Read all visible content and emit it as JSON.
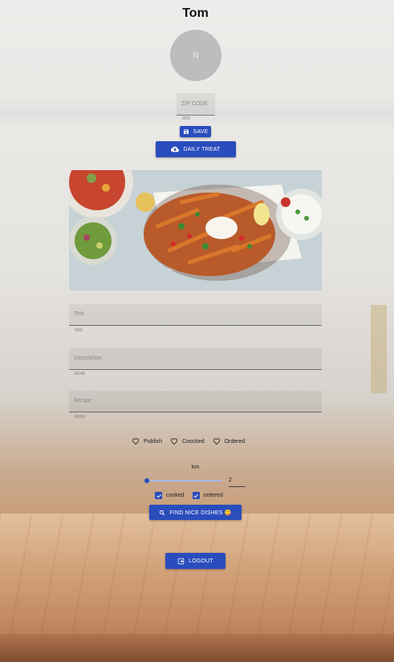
{
  "profile": {
    "name": "Tom",
    "avatar_initial": "N"
  },
  "zip": {
    "placeholder": "ZIP CODE",
    "value": "",
    "counter": "0/20"
  },
  "buttons": {
    "save": "SAVE",
    "daily_treat": "DAILY TREAT",
    "find_dishes": "FIND NICE DISHES 😋",
    "logout": "LOGOUT"
  },
  "form": {
    "title": {
      "label": "Title",
      "counter": "0/20"
    },
    "description": {
      "label": "Description",
      "counter": "0/140"
    },
    "recipe": {
      "label": "Recipe",
      "counter": "0/500"
    }
  },
  "status_options": [
    "Publish",
    "Coocked",
    "Ordered"
  ],
  "filter": {
    "unit_label": "km",
    "distance_value": "2",
    "checkboxes": [
      {
        "label": "cooked",
        "checked": true
      },
      {
        "label": "ordered",
        "checked": true
      }
    ]
  },
  "colors": {
    "primary": "#2a4dbd",
    "avatar_bg": "#bdbdbd"
  },
  "icons": {
    "save": "floppy-disk-icon",
    "daily_treat": "cloud-upload-icon",
    "find": "search-icon",
    "logout": "logout-icon",
    "status": "heart-outline-icon"
  }
}
